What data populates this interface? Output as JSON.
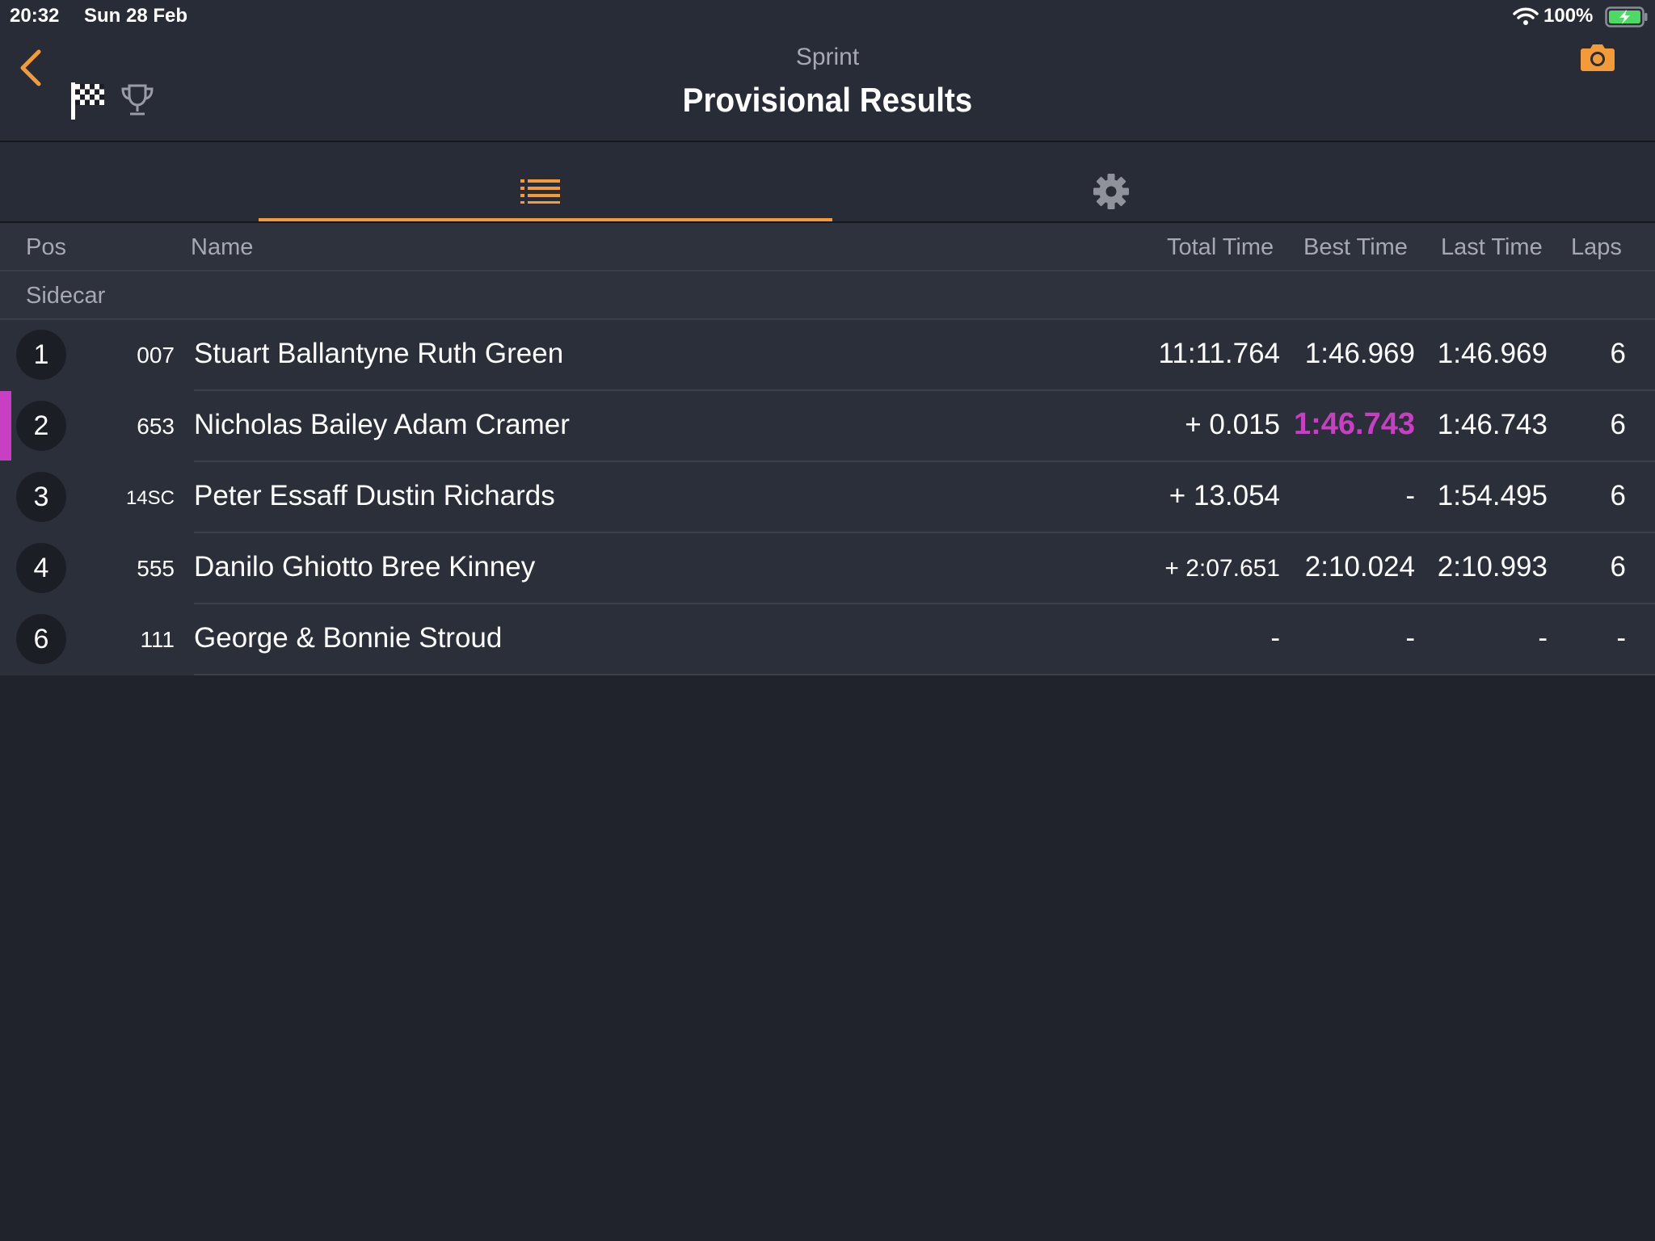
{
  "status_bar": {
    "time": "20:32",
    "date": "Sun 28 Feb",
    "battery": "100%"
  },
  "header": {
    "subtitle": "Sprint",
    "title": "Provisional Results"
  },
  "columns": {
    "pos": "Pos",
    "name": "Name",
    "total_time": "Total Time",
    "best_time": "Best Time",
    "last_time": "Last Time",
    "laps": "Laps"
  },
  "section": "Sidecar",
  "colors": {
    "accent": "#f29b38",
    "best_highlight": "#c93fc4"
  },
  "rows": [
    {
      "pos": "1",
      "number": "007",
      "name": "Stuart Ballantyne Ruth Green",
      "total": "11:11.764",
      "best": "1:46.969",
      "last": "1:46.969",
      "laps": "6"
    },
    {
      "pos": "2",
      "number": "653",
      "name": "Nicholas Bailey Adam Cramer",
      "total": "+ 0.015",
      "best": "1:46.743",
      "last": "1:46.743",
      "laps": "6"
    },
    {
      "pos": "3",
      "number": "14SC",
      "name": "Peter Essaff Dustin Richards",
      "total": "+ 13.054",
      "best": "-",
      "last": "1:54.495",
      "laps": "6"
    },
    {
      "pos": "4",
      "number": "555",
      "name": "Danilo Ghiotto Bree Kinney",
      "total": "+ 2:07.651",
      "best": "2:10.024",
      "last": "2:10.993",
      "laps": "6"
    },
    {
      "pos": "6",
      "number": "111",
      "name": "George & Bonnie Stroud",
      "total": "-",
      "best": "-",
      "last": "-",
      "laps": "-"
    }
  ]
}
